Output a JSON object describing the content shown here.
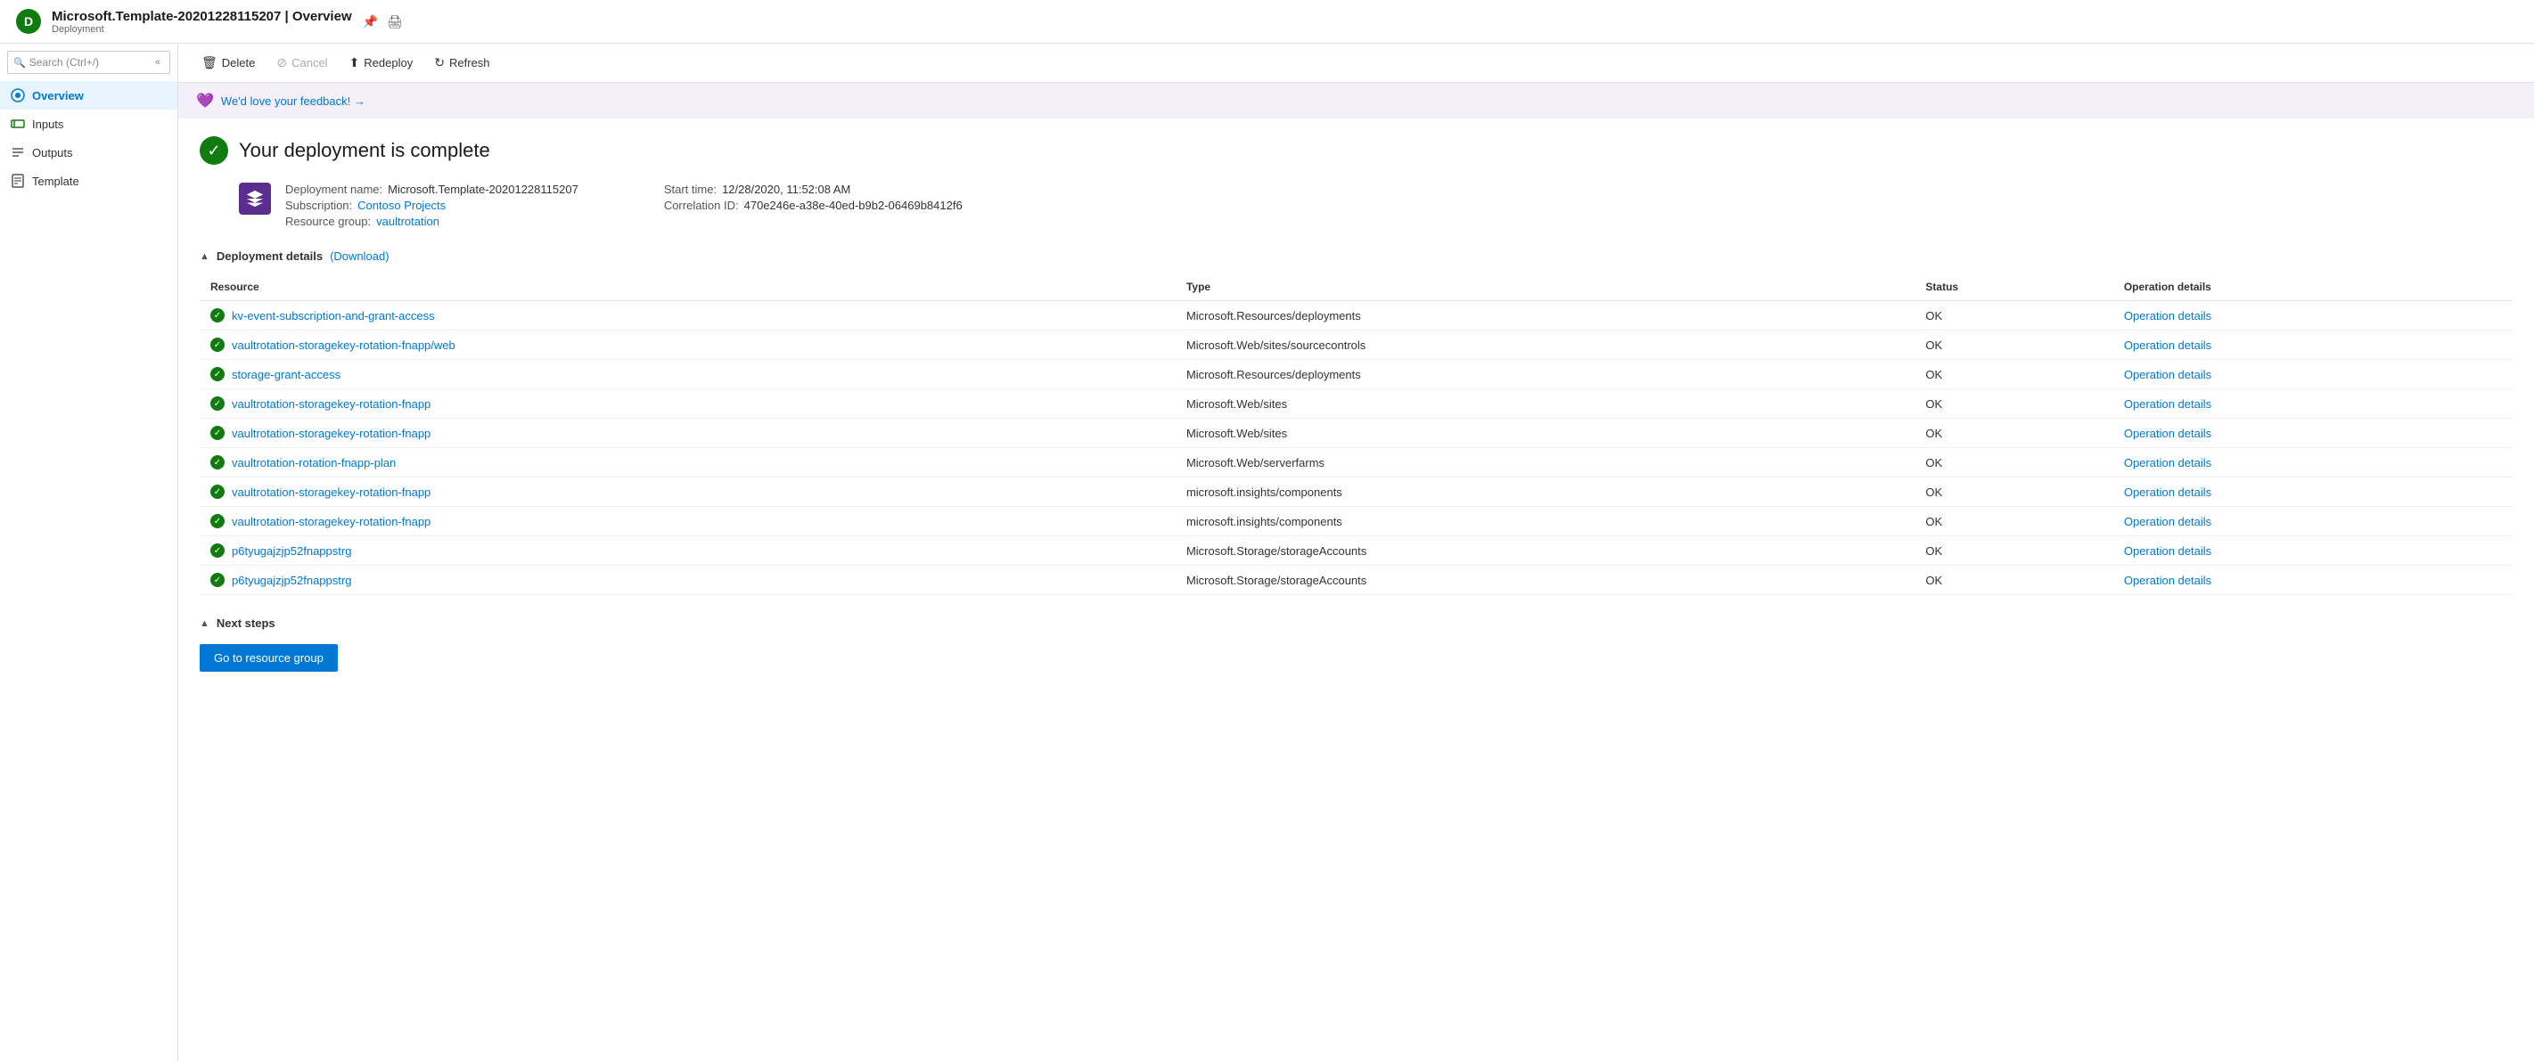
{
  "header": {
    "title": "Microsoft.Template-20201228115207 | Overview",
    "subtitle": "Deployment",
    "pin_icon": "📌",
    "print_icon": "🖨"
  },
  "search": {
    "placeholder": "Search (Ctrl+/)"
  },
  "toolbar": {
    "delete_label": "Delete",
    "cancel_label": "Cancel",
    "redeploy_label": "Redeploy",
    "refresh_label": "Refresh"
  },
  "feedback": {
    "text": "We'd love your feedback! →"
  },
  "deployment": {
    "complete_text": "Your deployment is complete",
    "name_label": "Deployment name:",
    "name_value": "Microsoft.Template-20201228115207",
    "subscription_label": "Subscription:",
    "subscription_value": "Contoso Projects",
    "resource_group_label": "Resource group:",
    "resource_group_value": "vaultrotation",
    "start_time_label": "Start time:",
    "start_time_value": "12/28/2020, 11:52:08 AM",
    "correlation_id_label": "Correlation ID:",
    "correlation_id_value": "470e246e-a38e-40ed-b9b2-06469b8412f6"
  },
  "deployment_details": {
    "section_title": "Deployment details",
    "download_label": "(Download)",
    "columns": [
      "Resource",
      "Type",
      "Status",
      "Operation details"
    ],
    "rows": [
      {
        "resource": "kv-event-subscription-and-grant-access",
        "type": "Microsoft.Resources/deployments",
        "status": "OK",
        "operation": "Operation details"
      },
      {
        "resource": "vaultrotation-storagekey-rotation-fnapp/web",
        "type": "Microsoft.Web/sites/sourcecontrols",
        "status": "OK",
        "operation": "Operation details"
      },
      {
        "resource": "storage-grant-access",
        "type": "Microsoft.Resources/deployments",
        "status": "OK",
        "operation": "Operation details"
      },
      {
        "resource": "vaultrotation-storagekey-rotation-fnapp",
        "type": "Microsoft.Web/sites",
        "status": "OK",
        "operation": "Operation details"
      },
      {
        "resource": "vaultrotation-storagekey-rotation-fnapp",
        "type": "Microsoft.Web/sites",
        "status": "OK",
        "operation": "Operation details"
      },
      {
        "resource": "vaultrotation-rotation-fnapp-plan",
        "type": "Microsoft.Web/serverfarms",
        "status": "OK",
        "operation": "Operation details"
      },
      {
        "resource": "vaultrotation-storagekey-rotation-fnapp",
        "type": "microsoft.insights/components",
        "status": "OK",
        "operation": "Operation details"
      },
      {
        "resource": "vaultrotation-storagekey-rotation-fnapp",
        "type": "microsoft.insights/components",
        "status": "OK",
        "operation": "Operation details"
      },
      {
        "resource": "p6tyugajzjp52fnappstrg",
        "type": "Microsoft.Storage/storageAccounts",
        "status": "OK",
        "operation": "Operation details"
      },
      {
        "resource": "p6tyugajzjp52fnappstrg",
        "type": "Microsoft.Storage/storageAccounts",
        "status": "OK",
        "operation": "Operation details"
      }
    ]
  },
  "next_steps": {
    "section_title": "Next steps",
    "go_to_rg_label": "Go to resource group"
  },
  "sidebar": {
    "items": [
      {
        "label": "Overview",
        "icon": "overview"
      },
      {
        "label": "Inputs",
        "icon": "inputs"
      },
      {
        "label": "Outputs",
        "icon": "outputs"
      },
      {
        "label": "Template",
        "icon": "template"
      }
    ]
  },
  "colors": {
    "accent": "#0078d4",
    "success": "#107c10",
    "purple": "#5c2d91"
  }
}
